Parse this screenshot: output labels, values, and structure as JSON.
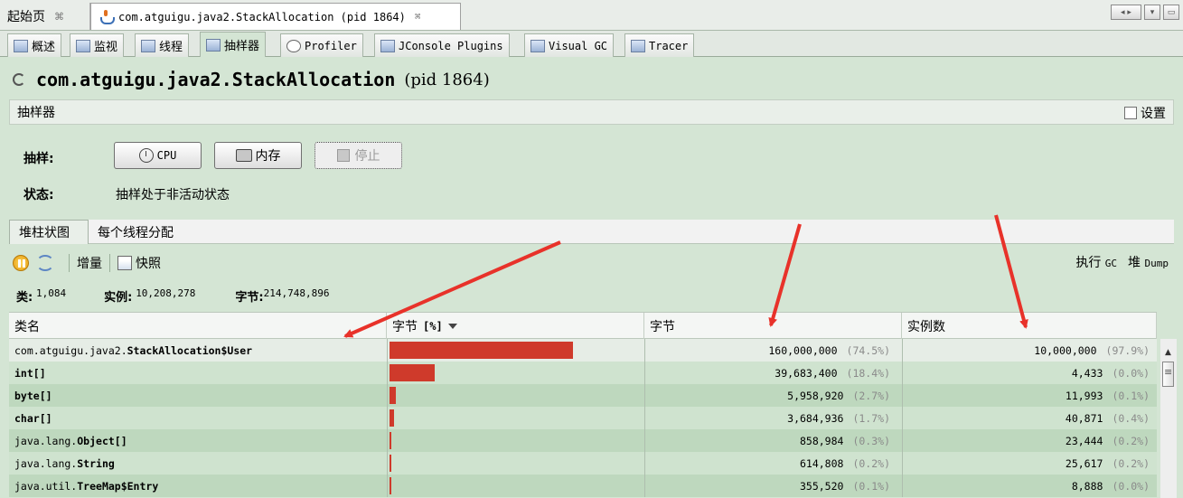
{
  "doc_tabs": [
    {
      "label": "起始页",
      "pin": "⌘"
    },
    {
      "label": "com.atguigu.java2.StackAllocation (pid 1864)",
      "pin": "⌘"
    }
  ],
  "plugin_tabs": [
    "概述",
    "监视",
    "线程",
    "抽样器",
    "Profiler",
    "JConsole Plugins",
    "Visual GC",
    "Tracer"
  ],
  "app": {
    "name": "com.atguigu.java2.StackAllocation",
    "pid": "(pid 1864)"
  },
  "sampler": {
    "header": "抽样器",
    "settings_label": "设置",
    "sample_label": "抽样:",
    "cpu_button": "CPU",
    "memory_button": "内存",
    "stop_button": "停止",
    "status_label": "状态:",
    "status_text": "抽样处于非活动状态"
  },
  "view_tabs": [
    "堆柱状图",
    "每个线程分配"
  ],
  "toolbar": {
    "delta": "增量",
    "snapshot": "快照",
    "perform_gc": "执行",
    "gc_suffix": "GC",
    "heap": "堆",
    "dump": "Dump"
  },
  "summary": {
    "classes_label": "类:",
    "classes": "1,084",
    "instances_label": "实例:",
    "instances": "10,208,278",
    "bytes_label": "字节:",
    "bytes": "214,748,896"
  },
  "table": {
    "headers": {
      "class_name": "类名",
      "bytes_pct": "字节",
      "bytes_pct_suffix": "[%]",
      "bytes": "字节",
      "instances": "实例数"
    },
    "rows": [
      {
        "prefix": "com.atguigu.java2.",
        "name": "StackAllocation$User",
        "bytes": "160,000,000",
        "bytes_pct": "(74.5%)",
        "instances": "10,000,000",
        "inst_pct": "(97.9%)",
        "share": 74.5
      },
      {
        "prefix": "",
        "name": "int[]",
        "bytes": "39,683,400",
        "bytes_pct": "(18.4%)",
        "instances": "4,433",
        "inst_pct": "(0.0%)",
        "share": 18.4
      },
      {
        "prefix": "",
        "name": "byte[]",
        "bytes": "5,958,920",
        "bytes_pct": "(2.7%)",
        "instances": "11,993",
        "inst_pct": "(0.1%)",
        "share": 2.7
      },
      {
        "prefix": "",
        "name": "char[]",
        "bytes": "3,684,936",
        "bytes_pct": "(1.7%)",
        "instances": "40,871",
        "inst_pct": "(0.4%)",
        "share": 1.7
      },
      {
        "prefix": "java.lang.",
        "name": "Object[]",
        "bytes": "858,984",
        "bytes_pct": "(0.3%)",
        "instances": "23,444",
        "inst_pct": "(0.2%)",
        "share": 0.3
      },
      {
        "prefix": "java.lang.",
        "name": "String",
        "bytes": "614,808",
        "bytes_pct": "(0.2%)",
        "instances": "25,617",
        "inst_pct": "(0.2%)",
        "share": 0.2
      },
      {
        "prefix": "java.util.",
        "name": "TreeMap$Entry",
        "bytes": "355,520",
        "bytes_pct": "(0.1%)",
        "instances": "8,888",
        "inst_pct": "(0.0%)",
        "share": 0.1
      }
    ]
  },
  "colors": {
    "bar": "#cf3a2b",
    "annotation_arrow": "#e8322a",
    "panel_bg": "#d4e5d4"
  }
}
